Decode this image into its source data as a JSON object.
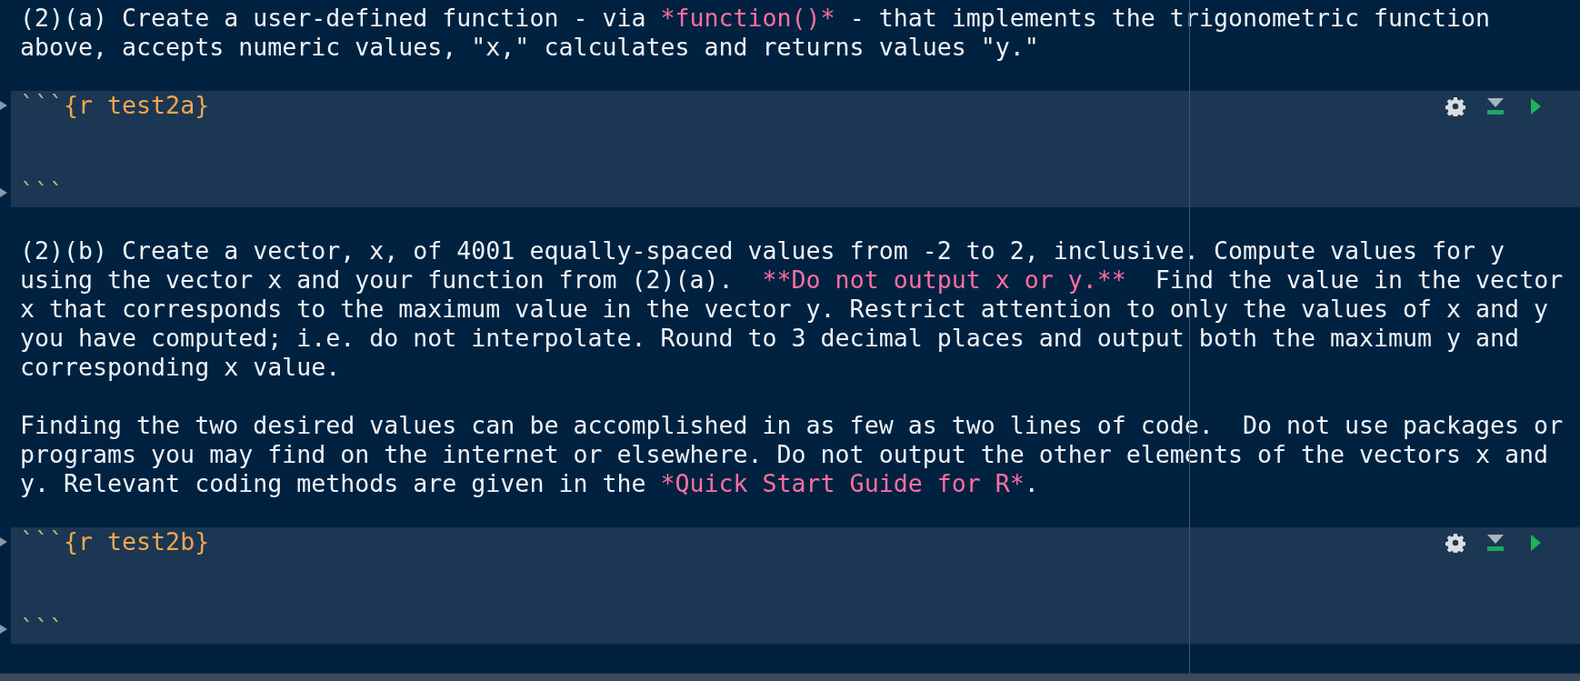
{
  "blocks": [
    {
      "kind": "text",
      "lines": [
        [
          {
            "text": "(2)(a) Create a user-defined function - via ",
            "emphasis": false
          },
          {
            "text": "*function()*",
            "emphasis": true
          },
          {
            "text": " - that implements the trigonometric function",
            "emphasis": false
          }
        ],
        [
          {
            "text": "above, accepts numeric values, \"x,\" calculates and returns values \"y.\"",
            "emphasis": false
          }
        ]
      ]
    },
    {
      "kind": "chunk",
      "fence": "```",
      "label": "{r test2a}",
      "close": "```"
    },
    {
      "kind": "text",
      "lines": [
        [
          {
            "text": "(2)(b) Create a vector, x, of 4001 equally-spaced values from -2 to 2, inclusive. Compute values for y",
            "emphasis": false
          }
        ],
        [
          {
            "text": "using the vector x and your function from (2)(a).  ",
            "emphasis": false
          },
          {
            "text": "**Do not output x or y.**",
            "emphasis": true
          },
          {
            "text": "  Find the value in the vector",
            "emphasis": false
          }
        ],
        [
          {
            "text": "x that corresponds to the maximum value in the vector y. Restrict attention to only the values of x and y",
            "emphasis": false
          }
        ],
        [
          {
            "text": "you have computed; i.e. do not interpolate. Round to 3 decimal places and output both the maximum y and",
            "emphasis": false
          }
        ],
        [
          {
            "text": "corresponding x value.",
            "emphasis": false
          }
        ]
      ]
    },
    {
      "kind": "text",
      "lines": [
        [
          {
            "text": "Finding the two desired values can be accomplished in as few as two lines of code.  Do not use packages or",
            "emphasis": false
          }
        ],
        [
          {
            "text": "programs you may find on the internet or elsewhere. Do not output the other elements of the vectors x and",
            "emphasis": false
          }
        ],
        [
          {
            "text": "y. Relevant coding methods are given in the ",
            "emphasis": false
          },
          {
            "text": "*Quick Start Guide for R*",
            "emphasis": true
          },
          {
            "text": ".",
            "emphasis": false
          }
        ]
      ]
    },
    {
      "kind": "chunk",
      "fence": "```",
      "label": "{r test2b}",
      "close": "```"
    }
  ]
}
